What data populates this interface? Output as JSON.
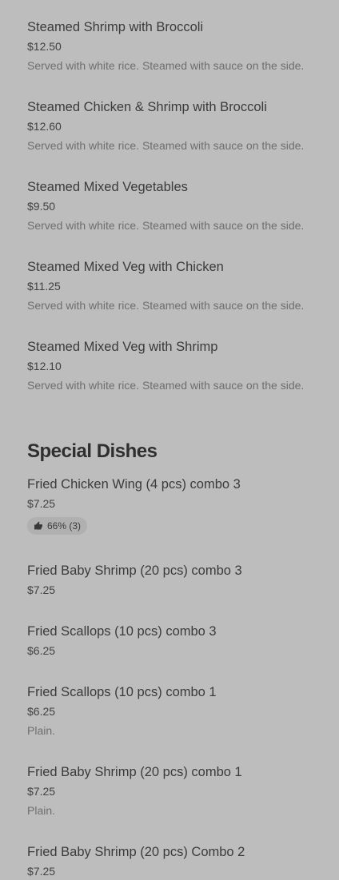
{
  "top_items": [
    {
      "name": "Steamed Shrimp with Broccoli",
      "price": "$12.50",
      "desc": "Served with white rice. Steamed with sauce on the side."
    },
    {
      "name": "Steamed Chicken & Shrimp with Broccoli",
      "price": "$12.60",
      "desc": "Served with white rice. Steamed with sauce on the side."
    },
    {
      "name": "Steamed Mixed Vegetables",
      "price": "$9.50",
      "desc": "Served with white rice. Steamed with sauce on the side."
    },
    {
      "name": "Steamed Mixed Veg with Chicken",
      "price": "$11.25",
      "desc": "Served with white rice. Steamed with sauce on the side."
    },
    {
      "name": "Steamed Mixed Veg with Shrimp",
      "price": "$12.10",
      "desc": "Served with white rice. Steamed with sauce on the side."
    }
  ],
  "special": {
    "title": "Special Dishes",
    "items": [
      {
        "name": "Fried Chicken Wing (4 pcs) combo 3",
        "price": "$7.25",
        "rating": "66% (3)"
      },
      {
        "name": "Fried Baby Shrimp (20 pcs) combo 3",
        "price": "$7.25"
      },
      {
        "name": "Fried Scallops (10 pcs) combo 3",
        "price": "$6.25"
      },
      {
        "name": "Fried Scallops (10 pcs) combo 1",
        "price": "$6.25",
        "desc": "Plain."
      },
      {
        "name": "Fried Baby Shrimp (20 pcs) combo 1",
        "price": "$7.25",
        "desc": "Plain."
      },
      {
        "name": "Fried Baby Shrimp (20 pcs) Combo 2",
        "price": "$7.25"
      }
    ]
  },
  "icons": {
    "rating": "thumbs-up-icon"
  }
}
